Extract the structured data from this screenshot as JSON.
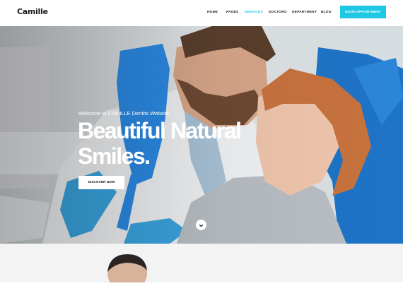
{
  "brand": {
    "logo": "Camille"
  },
  "nav": {
    "items": [
      {
        "label": "HOME",
        "active": false
      },
      {
        "label": "PAGES",
        "active": false
      },
      {
        "label": "SERVICES",
        "active": true
      },
      {
        "label": "DOCTORS",
        "active": false
      },
      {
        "label": "DEPARTMENT",
        "active": false
      },
      {
        "label": "BLOG",
        "active": false
      }
    ],
    "cta": "BOOK APPOINTMENT"
  },
  "hero": {
    "welcome": "Welcome to CAMILLE Dentits Website",
    "headline": "Beautiful Natural Smiles.",
    "button": "DISCOVER NOW",
    "scroll_icon": "chevron-down-icon"
  },
  "colors": {
    "accent": "#1dc8e4",
    "text": "#1a1a1a",
    "white": "#ffffff"
  }
}
